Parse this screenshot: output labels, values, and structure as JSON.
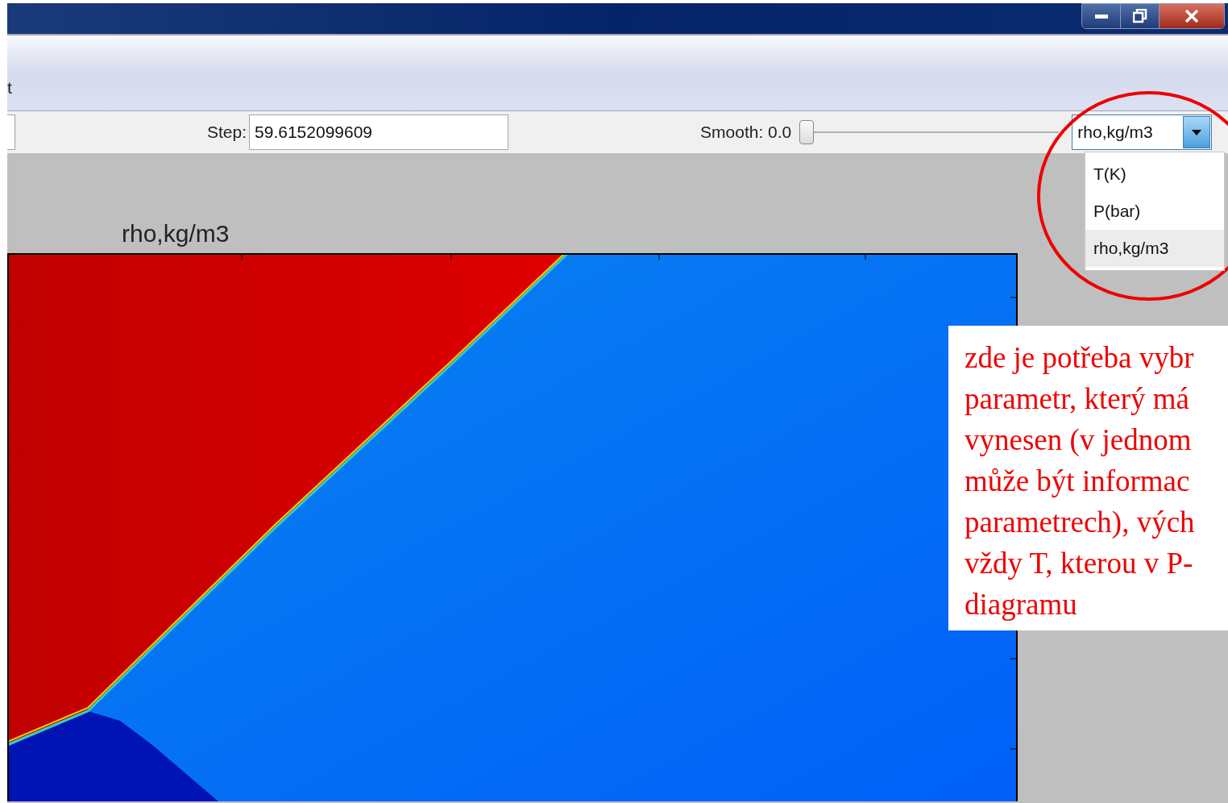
{
  "menu_bar": {
    "items": [
      {
        "label": "t"
      }
    ]
  },
  "toolbar": {
    "step": {
      "label": "Step:",
      "value": "59.6152099609"
    },
    "smooth": {
      "label": "Smooth: 0.0",
      "level": 0
    },
    "variable": {
      "value": "rho,kg/m3",
      "expanded": true,
      "options": [
        {
          "label": "T(K)",
          "selected": false
        },
        {
          "label": "P(bar)",
          "selected": false
        },
        {
          "label": "rho,kg/m3",
          "selected": true
        }
      ]
    }
  },
  "plot": {
    "title": "rho,kg/m3"
  },
  "annotation": {
    "lines": [
      "zde je potřeba vybr",
      "parametr, který má",
      "vynesen (v jednom",
      "může být informac",
      "parametrech), vých",
      "vždy T, kterou v P-",
      "diagramu"
    ]
  }
}
